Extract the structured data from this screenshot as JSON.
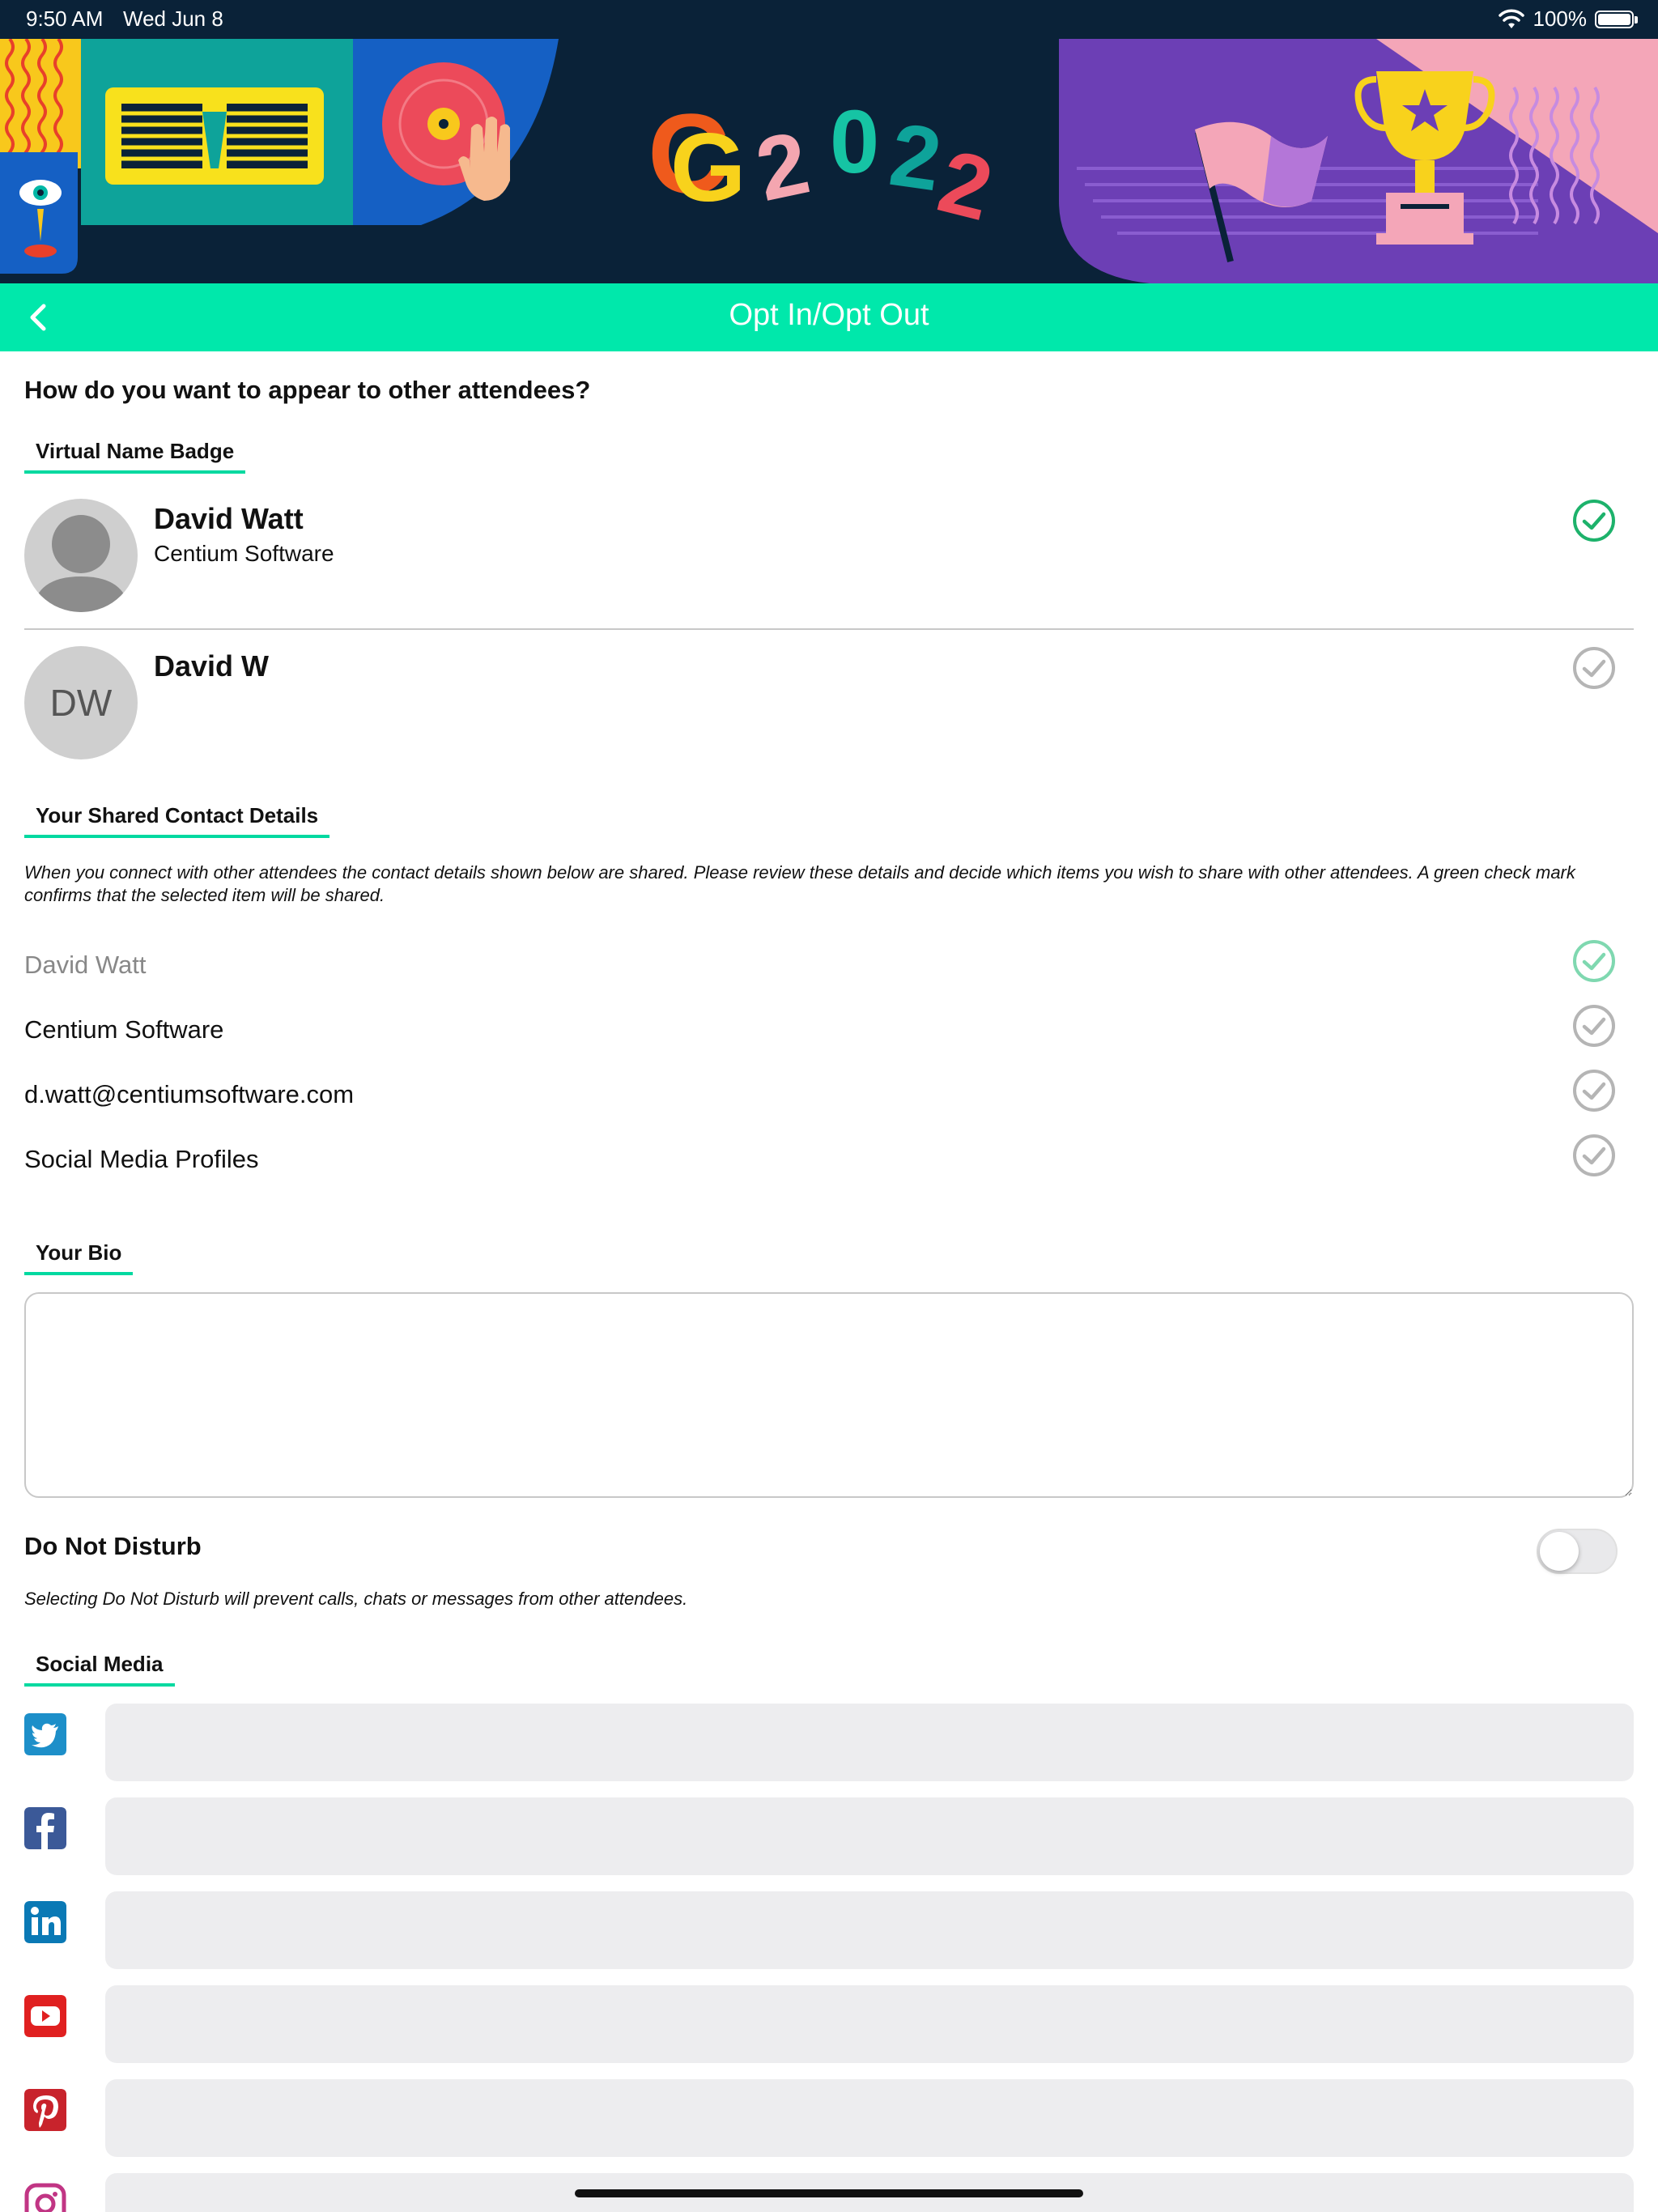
{
  "status_bar": {
    "time": "9:50 AM",
    "date": "Wed Jun 8",
    "battery": "100%",
    "battery_level": 1.0
  },
  "banner": {
    "logo_letters": "G",
    "year_text": "2022"
  },
  "nav": {
    "title": "Opt In/Opt Out"
  },
  "question": "How do you want to appear to other attendees?",
  "virtual_badge": {
    "section_label": "Virtual Name Badge",
    "options": [
      {
        "name": "David Watt",
        "company": "Centium Software",
        "avatar": "person-silhouette",
        "selected": true
      },
      {
        "name": "David W",
        "company": "",
        "avatar_initials": "DW",
        "selected": false
      }
    ]
  },
  "shared_contact": {
    "section_label": "Your Shared Contact Details",
    "description": "When you connect with other attendees the contact details shown below are shared. Please review these details and decide which items you wish to share with other attendees. A green check mark confirms that the selected item will be shared.",
    "items": [
      {
        "label": "David Watt",
        "checked": true,
        "disabled": true
      },
      {
        "label": "Centium Software",
        "checked": false
      },
      {
        "label": "d.watt@centiumsoftware.com",
        "checked": false
      },
      {
        "label": "Social Media Profiles",
        "checked": false
      }
    ]
  },
  "bio": {
    "section_label": "Your Bio",
    "value": ""
  },
  "do_not_disturb": {
    "label": "Do Not Disturb",
    "enabled": false,
    "description": "Selecting Do Not Disturb will prevent calls, chats or messages from other attendees."
  },
  "social_media": {
    "section_label": "Social Media",
    "fields": [
      {
        "icon": "twitter-icon",
        "color": "#1d8fc9",
        "value": ""
      },
      {
        "icon": "facebook-icon",
        "color": "#3b5998",
        "value": ""
      },
      {
        "icon": "linkedin-icon",
        "color": "#0a79b5",
        "value": ""
      },
      {
        "icon": "youtube-icon",
        "color": "#e02020",
        "value": ""
      },
      {
        "icon": "pinterest-icon",
        "color": "#c8232c",
        "value": ""
      },
      {
        "icon": "instagram-icon",
        "color": "#c13584",
        "value": ""
      }
    ]
  },
  "colors": {
    "accent": "#00e8ab",
    "check_green": "#1db26b",
    "check_gray": "#b5b5b5",
    "banner_bg": "#0a2238"
  }
}
